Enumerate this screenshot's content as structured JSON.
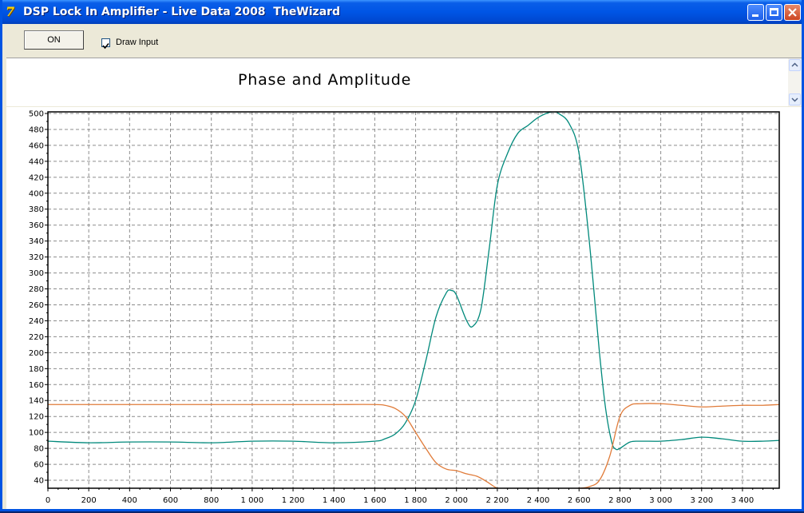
{
  "window": {
    "title": "DSP Lock In Amplifier - Live Data 2008  TheWizard",
    "app_icon": "app-logo-icon"
  },
  "toolbar": {
    "on_label": "ON",
    "draw_input_label": "Draw Input",
    "draw_input_checked": true
  },
  "chart_data": {
    "type": "line",
    "title": "Phase and Amplitude",
    "xlabel": "",
    "ylabel": "",
    "xlim": [
      0,
      3580
    ],
    "ylim": [
      30,
      502
    ],
    "grid": true,
    "legend": "none",
    "x_ticks": [
      "0",
      "200",
      "400",
      "600",
      "800",
      "1 000",
      "1 200",
      "1 400",
      "1 600",
      "1 800",
      "2 000",
      "2 200",
      "2 400",
      "2 600",
      "2 800",
      "3 000",
      "3 200",
      "3 400"
    ],
    "y_ticks": [
      "40",
      "60",
      "80",
      "100",
      "120",
      "140",
      "160",
      "180",
      "200",
      "220",
      "240",
      "260",
      "280",
      "300",
      "320",
      "340",
      "360",
      "380",
      "400",
      "420",
      "440",
      "460",
      "480",
      "500"
    ],
    "series": [
      {
        "color": "#00897b",
        "x": [
          0,
          200,
          400,
          600,
          800,
          1000,
          1200,
          1400,
          1600,
          1650,
          1700,
          1750,
          1800,
          1850,
          1900,
          1950,
          1975,
          2000,
          2050,
          2080,
          2120,
          2160,
          2200,
          2250,
          2300,
          2350,
          2400,
          2450,
          2480,
          2500,
          2550,
          2600,
          2650,
          2700,
          2730,
          2760,
          2780,
          2800,
          2850,
          2900,
          3000,
          3100,
          3200,
          3300,
          3400,
          3500,
          3580
        ],
        "y": [
          89,
          87,
          88,
          88,
          87,
          89,
          89,
          87,
          89,
          92,
          98,
          112,
          140,
          190,
          245,
          275,
          278,
          272,
          240,
          233,
          255,
          330,
          410,
          450,
          475,
          485,
          495,
          501,
          502,
          500,
          488,
          450,
          340,
          200,
          130,
          88,
          79,
          80,
          88,
          89,
          89,
          91,
          94,
          92,
          89,
          89,
          90
        ]
      },
      {
        "color": "#e07b39",
        "x": [
          0,
          200,
          400,
          600,
          800,
          1000,
          1200,
          1400,
          1600,
          1650,
          1700,
          1750,
          1800,
          1850,
          1900,
          1950,
          2000,
          2050,
          2100,
          2150,
          2200,
          2250,
          2300,
          2400,
          2500,
          2600,
          2650,
          2700,
          2750,
          2800,
          2850,
          2900,
          3000,
          3100,
          3200,
          3300,
          3400,
          3500,
          3580
        ],
        "y": [
          135,
          135,
          135,
          135,
          135,
          135,
          135,
          135,
          135,
          134,
          130,
          120,
          100,
          80,
          62,
          54,
          52,
          48,
          45,
          38,
          30,
          29,
          28,
          28,
          29,
          30,
          32,
          40,
          70,
          120,
          134,
          136,
          136,
          134,
          132,
          133,
          134,
          134,
          135
        ]
      }
    ]
  }
}
